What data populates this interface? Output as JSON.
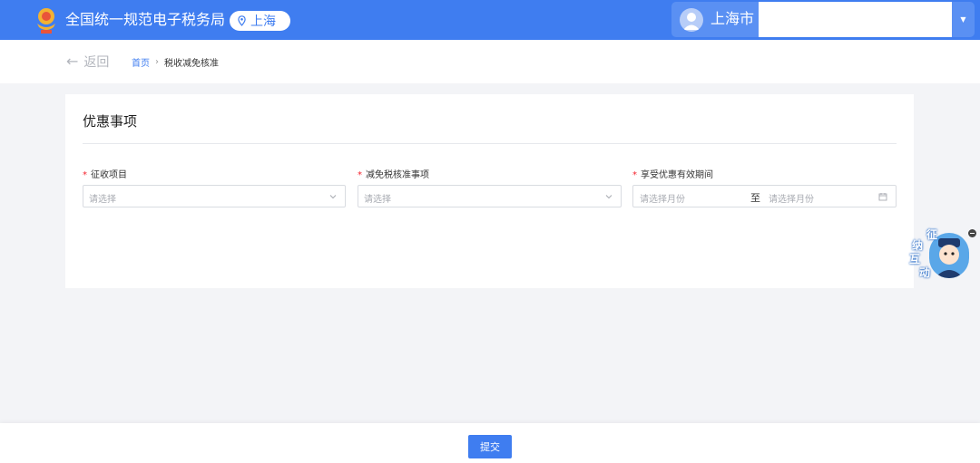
{
  "header": {
    "emblem_icon": "tax-emblem-icon",
    "site_title": "全国统一规范电子税务局",
    "region": "上海",
    "region_icon": "location-pin-icon",
    "user": {
      "name": "上海市",
      "avatar_icon": "user-avatar-icon",
      "dropdown_icon": "caret-down-icon"
    },
    "brand_color": "#3f7df0"
  },
  "breadcrumb": {
    "back_label": "返回",
    "back_icon": "arrow-left-icon",
    "home": "首页",
    "separator": "›",
    "current": "税收减免核准"
  },
  "card": {
    "title": "优惠事项",
    "fields": [
      {
        "label": "征收项目",
        "required_mark": "*",
        "placeholder": "请选择",
        "icon": "chevron-down-icon"
      },
      {
        "label": "减免税核准事项",
        "required_mark": "*",
        "placeholder": "请选择",
        "icon": "chevron-down-icon"
      },
      {
        "label": "享受优惠有效期间",
        "required_mark": "*",
        "start_placeholder": "请选择月份",
        "range_separator": "至",
        "end_placeholder": "请选择月份",
        "icon": "calendar-icon"
      }
    ]
  },
  "assistant": {
    "chars": [
      "征",
      "纳",
      "互",
      "动"
    ],
    "close_icon": "minimize-icon"
  },
  "footer": {
    "submit_label": "提交"
  }
}
